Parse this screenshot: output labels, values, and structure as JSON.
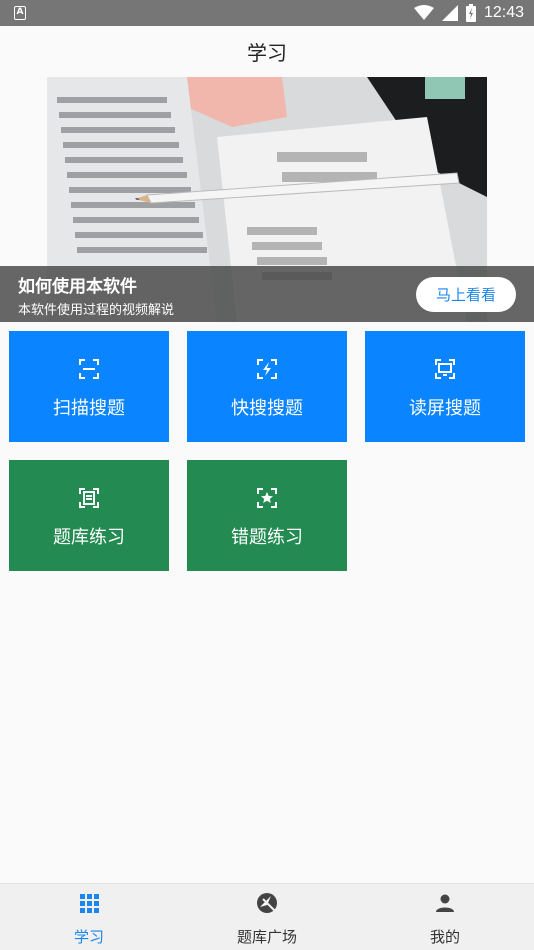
{
  "status_bar": {
    "time": "12:43",
    "notification_icon": "A"
  },
  "header": {
    "title": "学习"
  },
  "banner": {
    "title": "如何使用本软件",
    "subtitle": "本软件使用过程的视频解说",
    "button_label": "马上看看",
    "image": "answer-sheet-with-pencil"
  },
  "tiles": [
    {
      "label": "扫描搜题",
      "icon": "scan-icon",
      "color": "#0a84ff"
    },
    {
      "label": "快搜搜题",
      "icon": "flash-search-icon",
      "color": "#0a84ff"
    },
    {
      "label": "读屏搜题",
      "icon": "screen-read-icon",
      "color": "#0a84ff"
    },
    {
      "label": "题库练习",
      "icon": "question-bank-icon",
      "color": "#238a51"
    },
    {
      "label": "错题练习",
      "icon": "star-mistakes-icon",
      "color": "#238a51"
    }
  ],
  "bottom_nav": {
    "items": [
      {
        "label": "学习",
        "icon": "grid-icon",
        "active": true
      },
      {
        "label": "题库广场",
        "icon": "compass-icon",
        "active": false
      },
      {
        "label": "我的",
        "icon": "person-icon",
        "active": false
      }
    ],
    "active_color": "#1c86ee"
  }
}
